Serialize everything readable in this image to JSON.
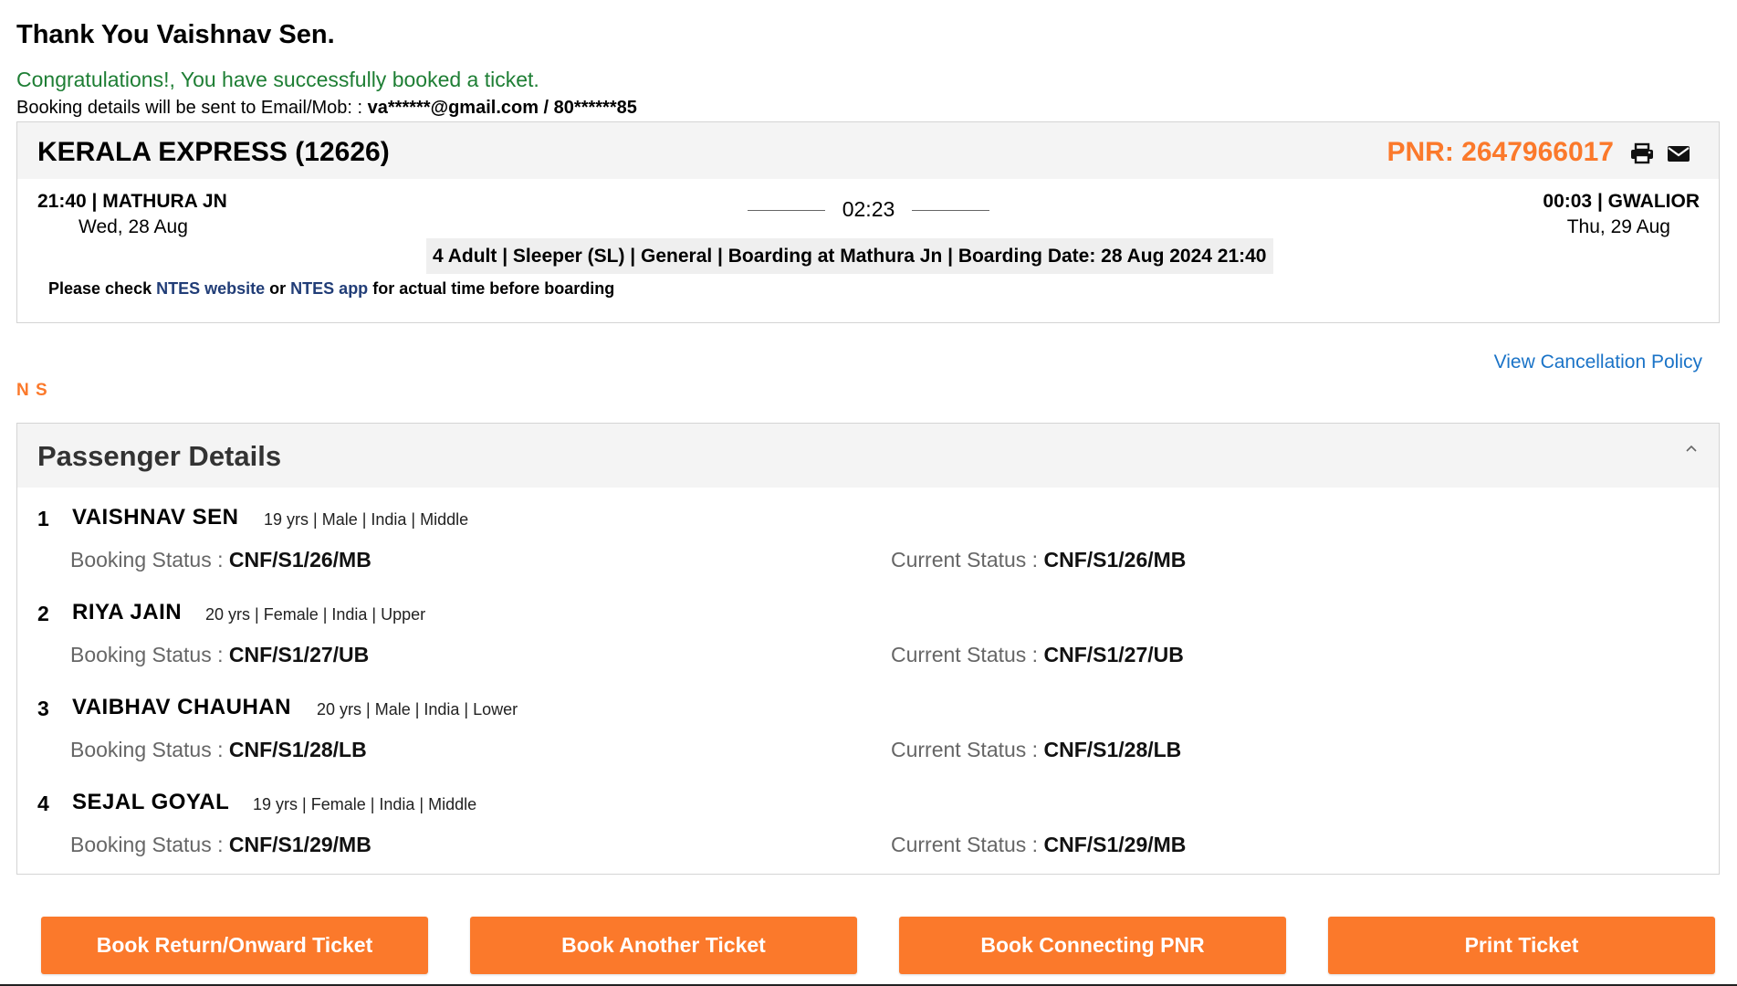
{
  "header": {
    "thanks": "Thank You Vaishnav Sen.",
    "congrats": "Congratulations!, You have successfully booked a ticket.",
    "booking_prefix": "Booking details will be sent to Email/Mob: :",
    "booking_contact": "va******@gmail.com / 80******85"
  },
  "journey": {
    "train": "KERALA EXPRESS (12626)",
    "pnr": "PNR: 2647966017",
    "from_time_station": "21:40 | MATHURA JN",
    "from_date": "Wed, 28 Aug",
    "duration": "02:23",
    "to_time_station": "00:03 | GWALIOR",
    "to_date": "Thu, 29 Aug",
    "summary": "4 Adult | Sleeper (SL) | General | Boarding at Mathura Jn | Boarding Date: 28 Aug 2024 21:40",
    "note_prefix": "Please check",
    "ntes_website": "NTES website",
    "note_or": "or",
    "ntes_app": "NTES app",
    "note_suffix": "for actual time before boarding"
  },
  "cancel_policy": "View Cancellation Policy",
  "ns_label": "N S",
  "passengers": {
    "title": "Passenger Details",
    "booking_status_label": "Booking Status :",
    "current_status_label": "Current Status :",
    "list": [
      {
        "num": "1",
        "name": "VAISHNAV SEN",
        "meta": "19 yrs | Male | India | Middle",
        "booking_status": "CNF/S1/26/MB",
        "current_status": "CNF/S1/26/MB"
      },
      {
        "num": "2",
        "name": "RIYA JAIN",
        "meta": "20 yrs | Female | India | Upper",
        "booking_status": "CNF/S1/27/UB",
        "current_status": "CNF/S1/27/UB"
      },
      {
        "num": "3",
        "name": "VAIBHAV CHAUHAN",
        "meta": "20 yrs | Male | India | Lower",
        "booking_status": "CNF/S1/28/LB",
        "current_status": "CNF/S1/28/LB"
      },
      {
        "num": "4",
        "name": "SEJAL GOYAL",
        "meta": "19 yrs | Female | India | Middle",
        "booking_status": "CNF/S1/29/MB",
        "current_status": "CNF/S1/29/MB"
      }
    ]
  },
  "actions": {
    "return_onward": "Book Return/Onward Ticket",
    "another": "Book Another Ticket",
    "connecting": "Book Connecting PNR",
    "print": "Print Ticket"
  },
  "colors": {
    "accent": "#fb792b",
    "success": "#1e7e34",
    "link": "#1a73c7",
    "ntes": "#213d77"
  },
  "icons": {
    "print": "print-icon",
    "mail": "mail-icon",
    "collapse": "chevron-up-icon"
  }
}
